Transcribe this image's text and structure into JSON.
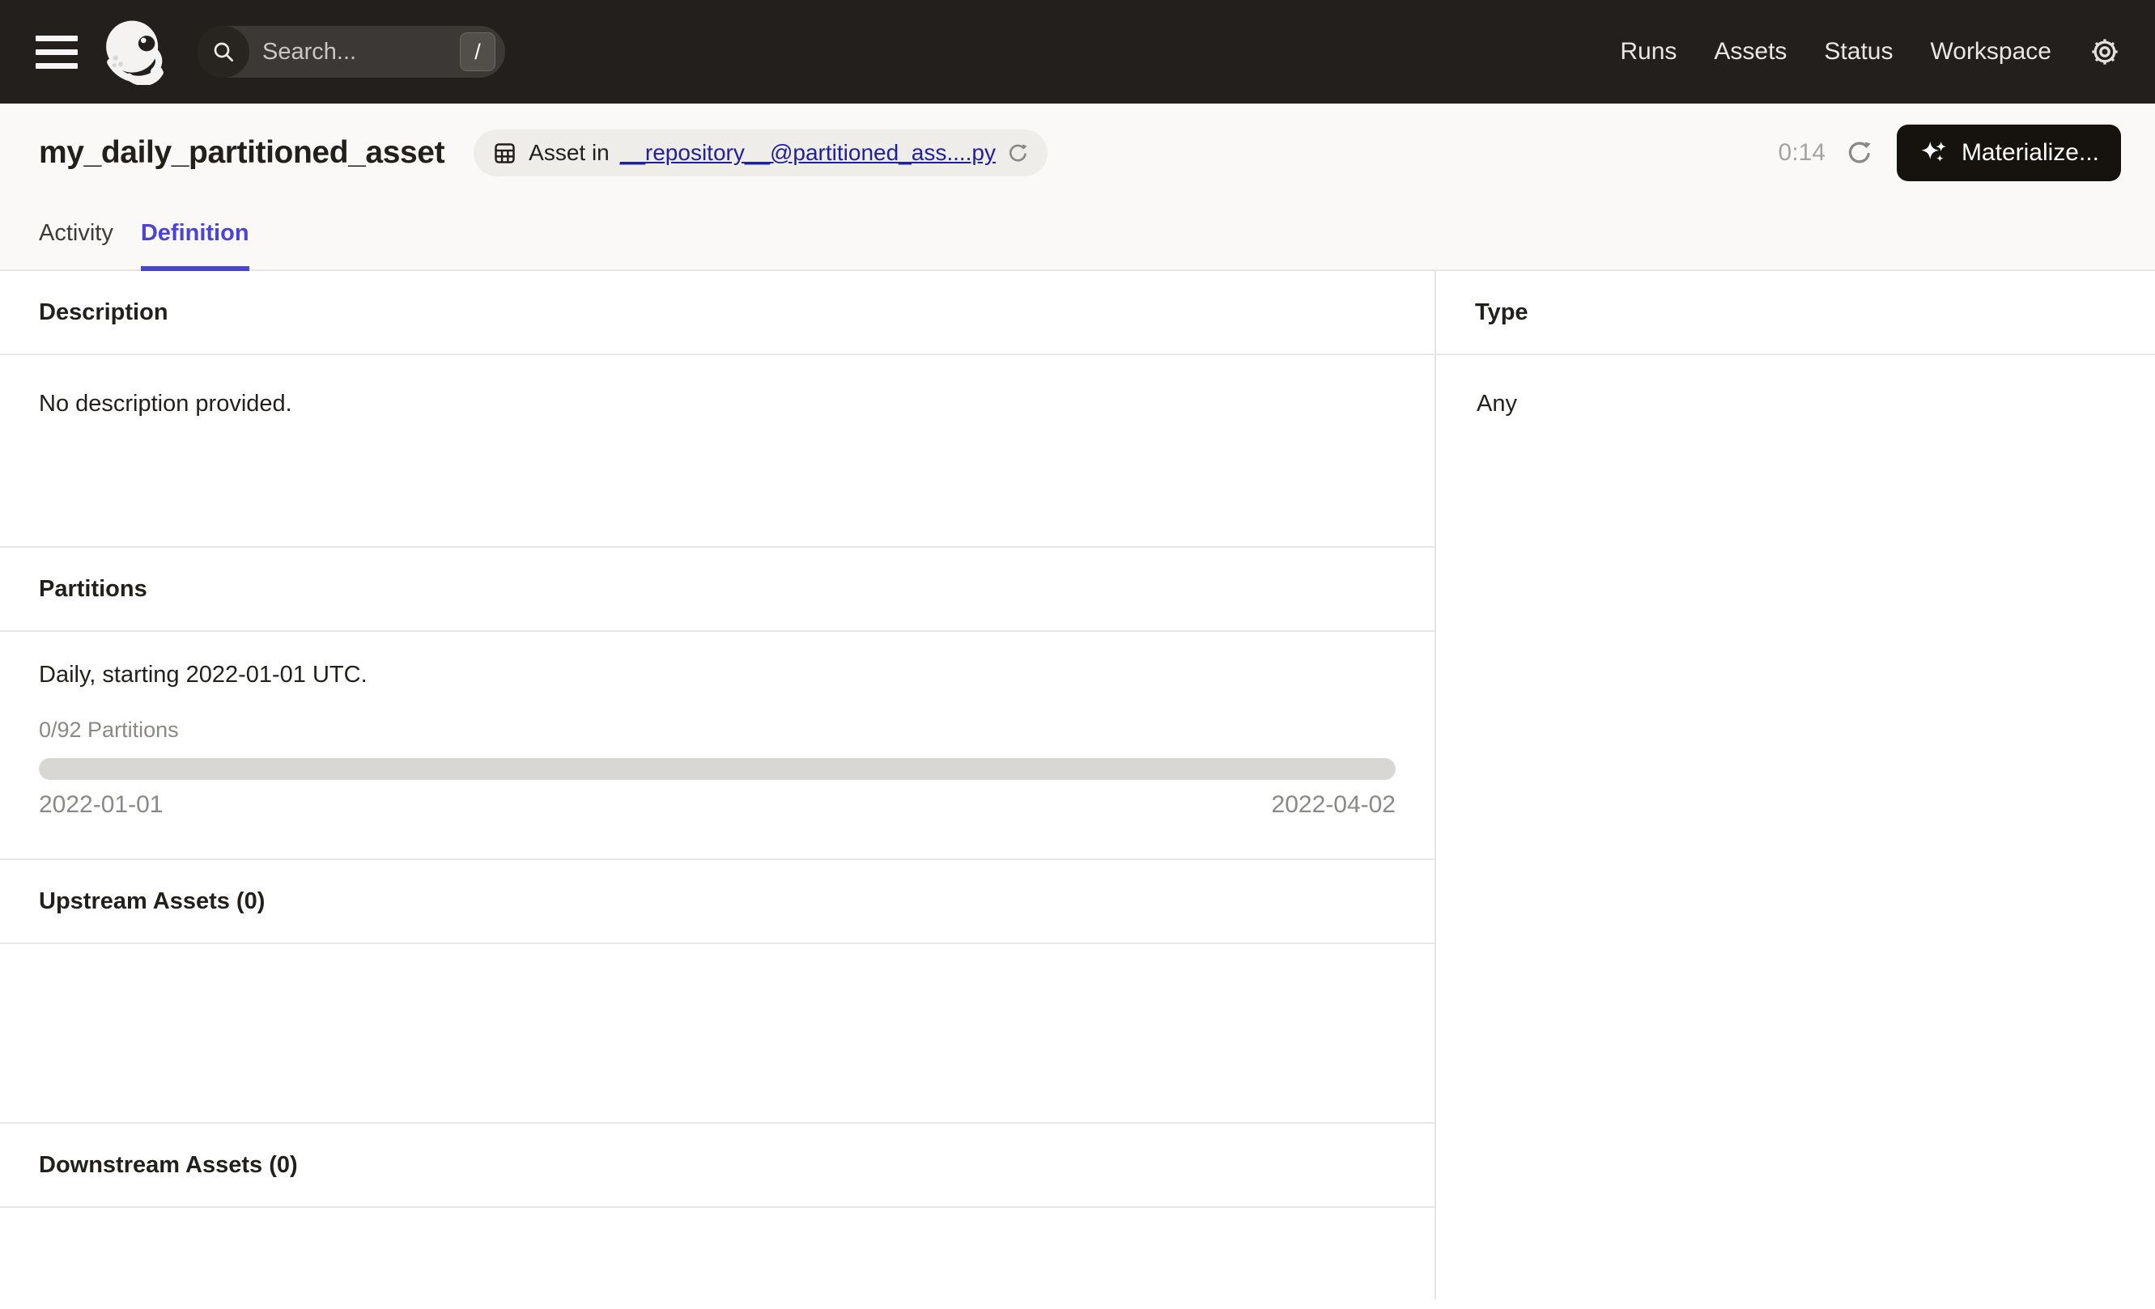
{
  "topbar": {
    "search": {
      "placeholder": "Search...",
      "shortcut_key": "/"
    },
    "nav_items": [
      {
        "label": "Runs"
      },
      {
        "label": "Assets"
      },
      {
        "label": "Status"
      },
      {
        "label": "Workspace"
      }
    ],
    "icons": {
      "menu": "hamburger",
      "logo": "dagster-octopus",
      "search": "magnifying-glass",
      "settings": "gear"
    }
  },
  "header": {
    "title": "my_daily_partitioned_asset",
    "asset_badge": {
      "icon": "asset-grid",
      "prefix": "Asset in",
      "link_text": "__repository__@partitioned_ass....py",
      "reload_icon": "circular-arrow"
    },
    "refresh_countdown": "0:14",
    "refresh_icon": "circular-arrow",
    "materialize": {
      "icon": "sparkles",
      "label": "Materialize..."
    }
  },
  "tabs": [
    {
      "label": "Activity",
      "active": false
    },
    {
      "label": "Definition",
      "active": true
    }
  ],
  "left": {
    "description": {
      "heading": "Description",
      "body": "No description provided."
    },
    "partitions": {
      "heading": "Partitions",
      "summary": "Daily, starting 2022-01-01 UTC.",
      "progress_label": "0/92 Partitions",
      "progress_percent": 0,
      "progress_style": "width:0%",
      "range_start": "2022-01-01",
      "range_end": "2022-04-02"
    },
    "upstream": {
      "heading": "Upstream Assets (0)"
    },
    "downstream": {
      "heading": "Downstream Assets (0)"
    }
  },
  "right": {
    "type": {
      "heading": "Type",
      "value": "Any"
    }
  },
  "colors": {
    "topbar_bg": "#231F1C",
    "header_bg": "#FAF9F7",
    "accent_tab": "#4A43D6",
    "link": "#21219B",
    "materialize_bg": "#16120E",
    "divider": "#E7E5E2",
    "progress_track": "#D9D7D4",
    "muted_text": "#8B8987"
  }
}
